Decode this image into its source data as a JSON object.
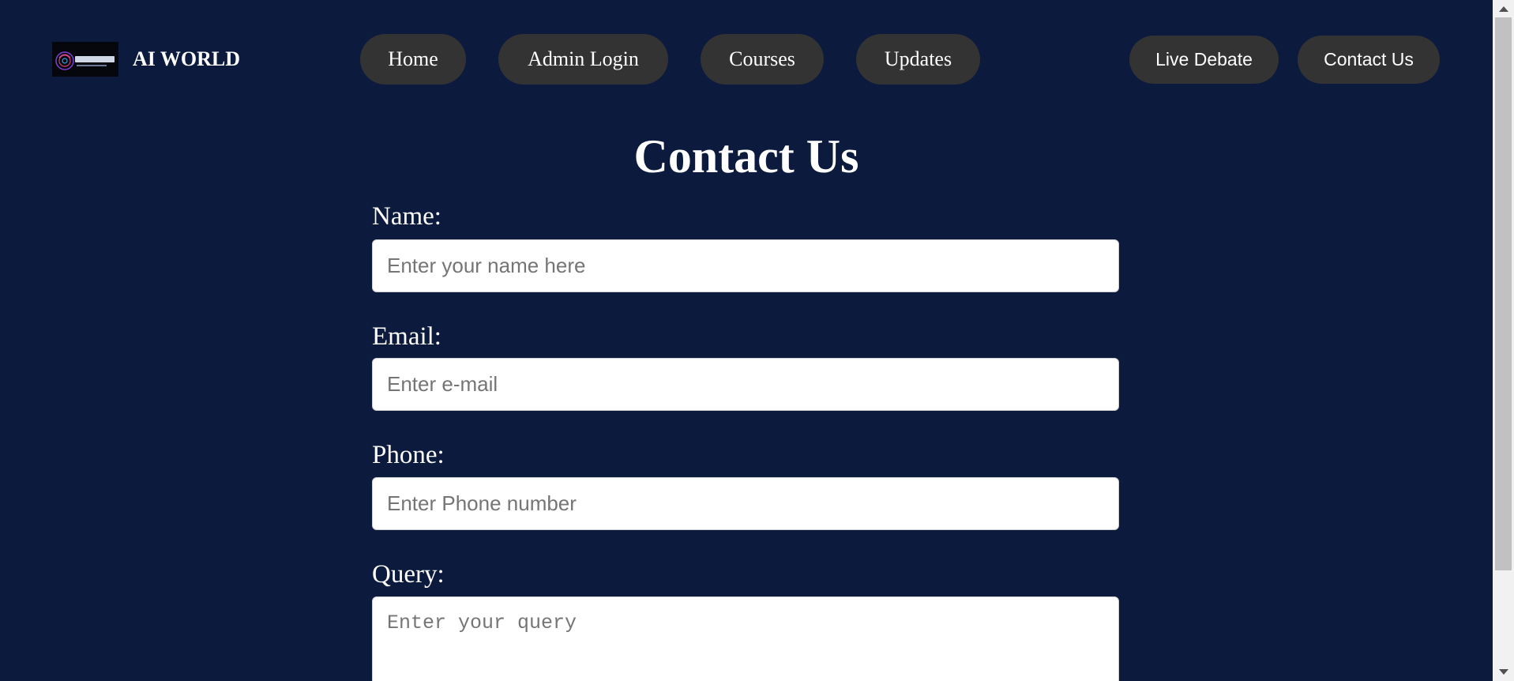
{
  "header": {
    "brand": "AI WORLD",
    "logo_alt": "Artificial"
  },
  "nav": {
    "home": "Home",
    "admin_login": "Admin Login",
    "courses": "Courses",
    "updates": "Updates",
    "live_debate": "Live Debate",
    "contact_us": "Contact Us"
  },
  "main": {
    "title": "Contact Us"
  },
  "form": {
    "name_label": "Name:",
    "name_placeholder": "Enter your name here",
    "email_label": "Email:",
    "email_placeholder": "Enter e-mail",
    "phone_label": "Phone:",
    "phone_placeholder": "Enter Phone number",
    "query_label": "Query:",
    "query_placeholder": "Enter your query"
  },
  "colors": {
    "background": "#0b1a3d",
    "nav_pill": "#333333",
    "text": "#ffffff"
  },
  "icons": {
    "scroll_up": "triangle-up-icon",
    "scroll_down": "triangle-down-icon"
  }
}
